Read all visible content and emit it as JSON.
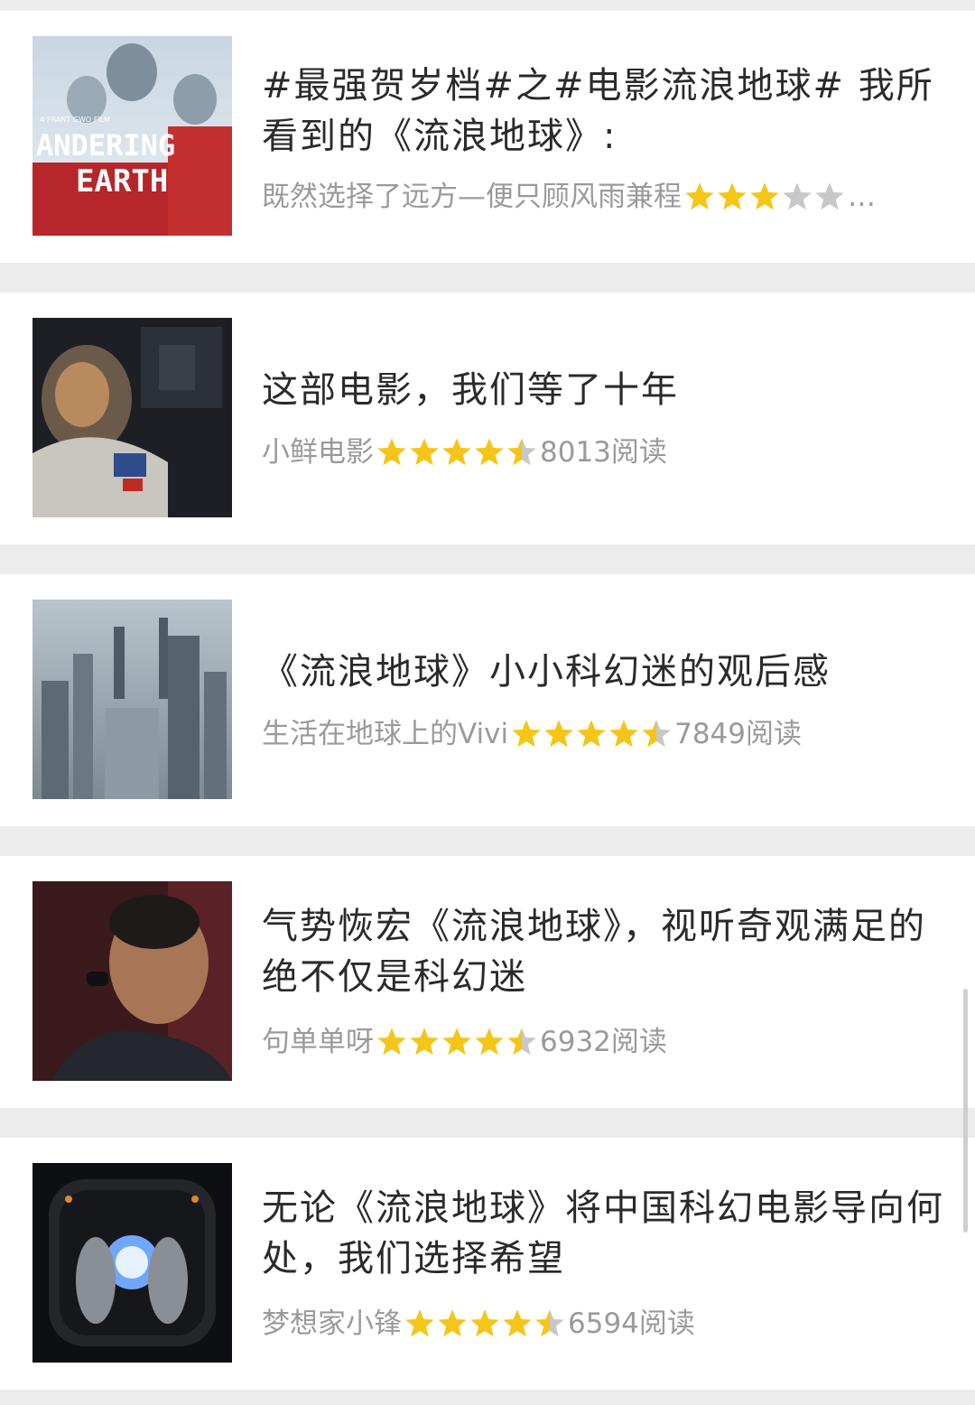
{
  "articles": [
    {
      "title": "#最强贺岁档#之#电影流浪地球# 我所看到的《流浪地球》:",
      "author": "既然选择了远方—便只顾风雨兼程",
      "rating": 3,
      "reads": "…",
      "thumb": "poster-wandering-earth-astronauts",
      "poster_text_1": "A FRANT GWO FILM",
      "poster_text_2": "ANDERING",
      "poster_text_3": "EARTH"
    },
    {
      "title": "这部电影，我们等了十年",
      "author": "小鲜电影",
      "rating": 4.5,
      "reads": "8013阅读",
      "thumb": "astronaut-portrait"
    },
    {
      "title": "《流浪地球》小小科幻迷的观后感",
      "author": "生活在地球上的Vivi",
      "rating": 4.5,
      "reads": "7849阅读",
      "thumb": "frozen-city"
    },
    {
      "title": "气势恢宏《流浪地球》，视听奇观满足的绝不仅是科幻迷",
      "author": "句单单呀",
      "rating": 4.5,
      "reads": "6932阅读",
      "thumb": "actor-headset"
    },
    {
      "title": "无论《流浪地球》将中国科幻电影导向何处，我们选择希望",
      "author": "梦想家小锋",
      "rating": 4.5,
      "reads": "6594阅读",
      "thumb": "spacecraft-hatch"
    }
  ],
  "colors": {
    "star_on": "#f5c518",
    "star_off": "#c8c8c8",
    "title": "#2a2a2a",
    "meta": "#9a9a9a"
  }
}
